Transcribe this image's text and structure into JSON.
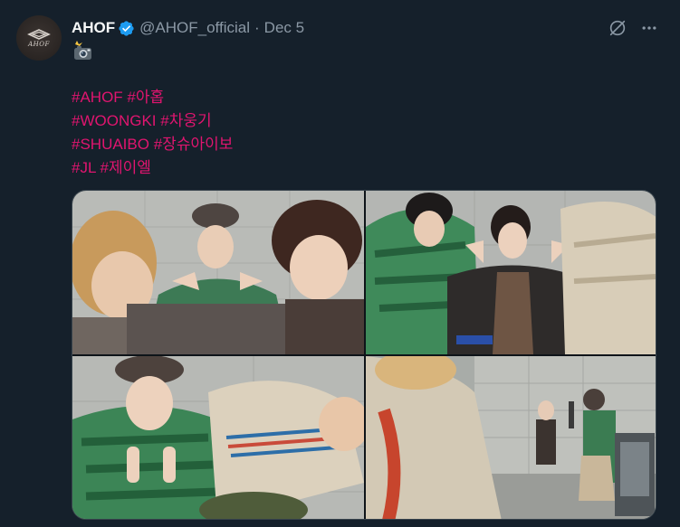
{
  "tweet": {
    "author_name": "AHOF",
    "handle": "@AHOF_official",
    "separator": "·",
    "date": "Dec 5",
    "avatar_text": "AHOF",
    "emoji": "camera-with-flash-emoji",
    "hashtag_lines": [
      {
        "tags": [
          "#AHOF",
          "#아홉"
        ]
      },
      {
        "tags": [
          "#WOONGKI",
          "#차웅기"
        ]
      },
      {
        "tags": [
          "#SHUAIBO",
          "#장슈아이보"
        ]
      },
      {
        "tags": [
          "#JL",
          "#제이엘"
        ]
      }
    ],
    "hashtag_color": "#e0156f"
  },
  "icons": {
    "verified": "verified-badge-icon",
    "grok": "grok-icon",
    "more": "more-icon"
  },
  "media": {
    "photos": [
      {
        "name": "photo-1"
      },
      {
        "name": "photo-2"
      },
      {
        "name": "photo-3"
      },
      {
        "name": "photo-4"
      }
    ]
  },
  "colors": {
    "background": "#15202b",
    "text": "#f7f9f9",
    "secondary": "#8b98a5",
    "verified": "#1d9bf0",
    "border": "#38444d"
  }
}
